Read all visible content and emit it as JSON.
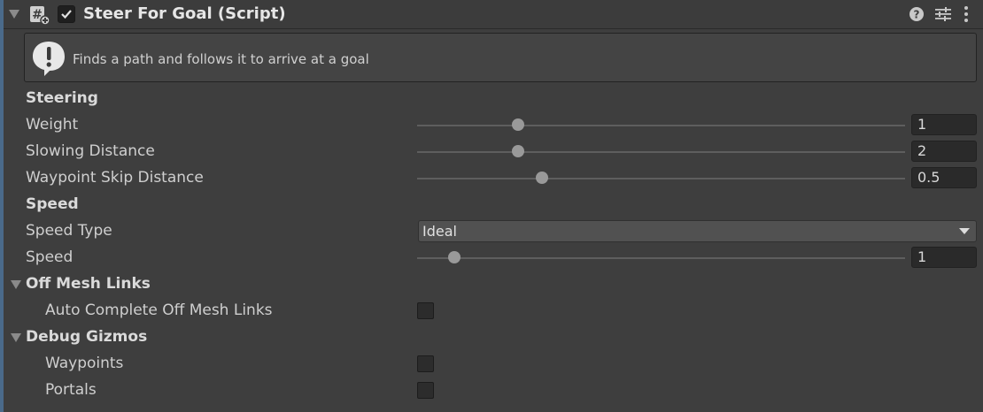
{
  "component": {
    "title": "Steer For Goal (Script)",
    "enabled": true,
    "icons": [
      "script-hash-icon",
      "help-icon",
      "presets-icon",
      "kebab-menu-icon"
    ]
  },
  "helpbox": {
    "message": "Finds a path and follows it to arrive at a goal"
  },
  "steering": {
    "header": "Steering",
    "weight": {
      "label": "Weight",
      "value": "1",
      "slider_fraction": 0.2
    },
    "slowing_distance": {
      "label": "Slowing Distance",
      "value": "2",
      "slider_fraction": 0.2
    },
    "waypoint_skip_distance": {
      "label": "Waypoint Skip Distance",
      "value": "0.5",
      "slider_fraction": 0.25
    }
  },
  "speed_section": {
    "header": "Speed",
    "speed_type": {
      "label": "Speed Type",
      "selected": "Ideal"
    },
    "speed": {
      "label": "Speed",
      "value": "1",
      "slider_fraction": 0.08
    }
  },
  "off_mesh_links": {
    "header": "Off Mesh Links",
    "auto_complete": {
      "label": "Auto Complete Off Mesh Links",
      "checked": false
    }
  },
  "debug_gizmos": {
    "header": "Debug Gizmos",
    "waypoints": {
      "label": "Waypoints",
      "checked": false
    },
    "portals": {
      "label": "Portals",
      "checked": false
    }
  }
}
